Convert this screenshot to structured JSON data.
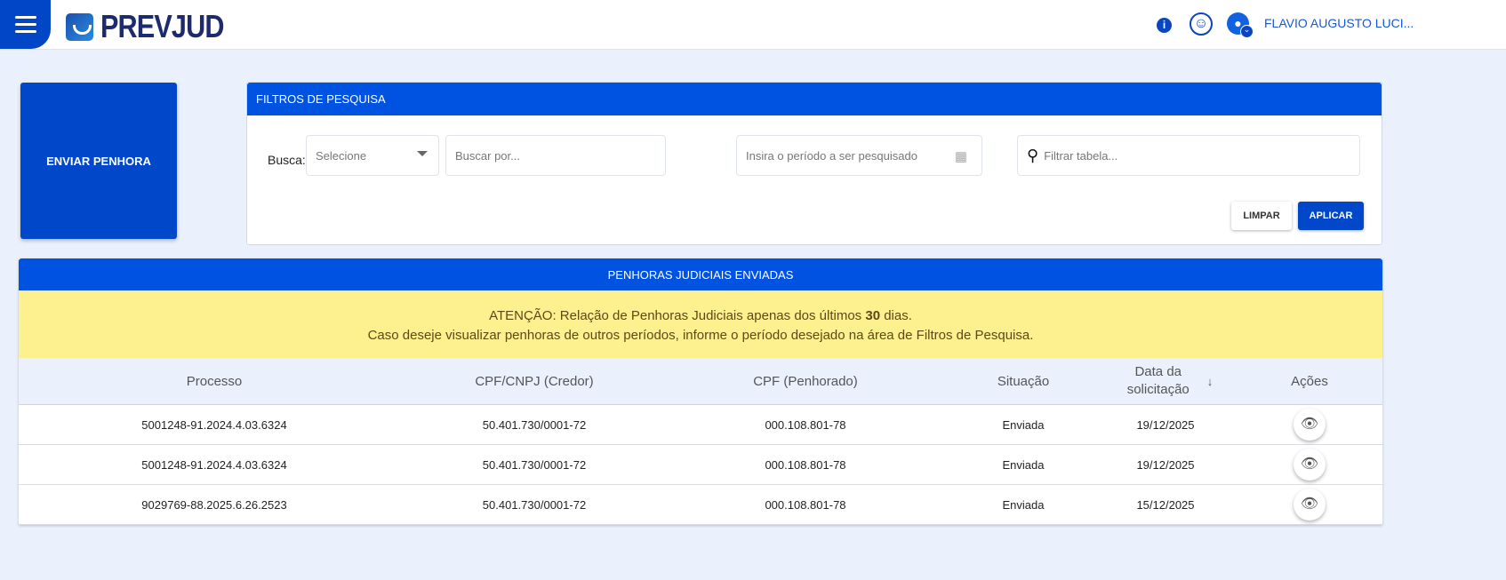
{
  "header": {
    "logo": "PREVJUD",
    "user_name": "FLAVIO AUGUSTO LUCI..."
  },
  "enviar_label": "ENVIAR PENHORA",
  "filters": {
    "title": "FILTROS DE PESQUISA",
    "busca_label": "Busca:",
    "select_value": "Selecione",
    "search_placeholder": "Buscar por...",
    "period_placeholder": "Insira o período a ser pesquisado",
    "table_filter_placeholder": "Filtrar tabela...",
    "clear": "LIMPAR",
    "apply": "APLICAR"
  },
  "table": {
    "title": "PENHORAS JUDICIAIS ENVIADAS",
    "alert_line1_pre": "ATENÇÃO: Relação de Penhoras Judiciais apenas dos últimos ",
    "alert_days": "30",
    "alert_line1_post": " dias.",
    "alert_line2": "Caso deseje visualizar penhoras de outros períodos, informe o período desejado na área de Filtros de Pesquisa.",
    "columns": [
      "Processo",
      "CPF/CNPJ (Credor)",
      "CPF (Penhorado)",
      "Situação",
      "Data da solicitação",
      "Ações"
    ],
    "rows": [
      [
        "5001248-91.2024.4.03.6324",
        "50.401.730/0001-72",
        "000.108.801-78",
        "Enviada",
        "19/12/2025"
      ],
      [
        "5001248-91.2024.4.03.6324",
        "50.401.730/0001-72",
        "000.108.801-78",
        "Enviada",
        "19/12/2025"
      ],
      [
        "9029769-88.2025.6.26.2523",
        "50.401.730/0001-72",
        "000.108.801-78",
        "Enviada",
        "15/12/2025"
      ]
    ]
  }
}
